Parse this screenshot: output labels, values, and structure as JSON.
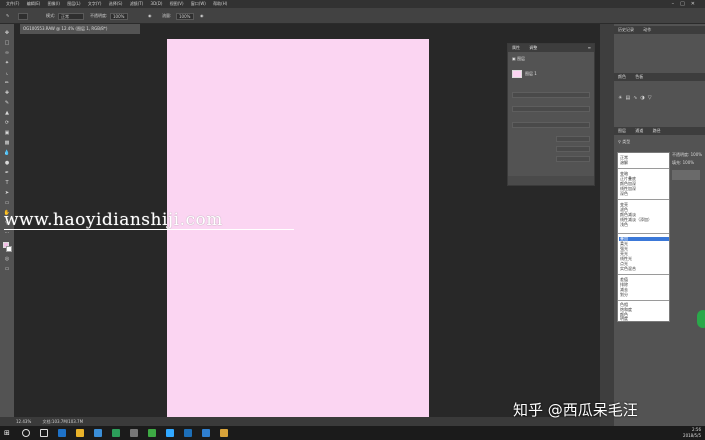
{
  "menubar": {
    "items": [
      "文件(F)",
      "编辑(E)",
      "图像(I)",
      "图层(L)",
      "文字(Y)",
      "选择(S)",
      "滤镜(T)",
      "3D(D)",
      "视图(V)",
      "窗口(W)",
      "帮助(H)"
    ]
  },
  "options": {
    "mode_label": "模式:",
    "mode_value": "正常",
    "opacity_label": "不透明度:",
    "opacity_value": "100%",
    "flow_label": "流量:",
    "flow_value": "100%",
    "smooth_label": "平滑:"
  },
  "doc_tab": "OG100553.RAW @ 12.4% (图层 1, RGB/8*)",
  "statusbar": {
    "zoom": "12.43%",
    "doc_info": "文档:103.7M/103.7M"
  },
  "watermark": "www.haoyidianshiji.com",
  "properties_panel": {
    "tabs": [
      "属性",
      "调整"
    ],
    "section": "图层",
    "layer_name": "图层 1"
  },
  "right_dock": {
    "panel_top_tabs": [
      "历史记录",
      "动作"
    ],
    "panel_mid_tabs": [
      "颜色",
      "色板"
    ],
    "layers_tabs": [
      "图层",
      "通道",
      "路径"
    ],
    "kind_label": "类型",
    "opacity_label": "不透明度:",
    "opacity_value": "100%",
    "fill_label": "填充:",
    "fill_value": "100%"
  },
  "blend_modes": {
    "group1": [
      "正常",
      "溶解"
    ],
    "group2": [
      "变暗",
      "正片叠底",
      "颜色加深",
      "线性加深",
      "深色"
    ],
    "group3": [
      "变亮",
      "滤色",
      "颜色减淡",
      "线性减淡（添加）",
      "浅色"
    ],
    "group4": [
      "叠加",
      "柔光",
      "强光",
      "亮光",
      "线性光",
      "点光",
      "实色混合"
    ],
    "group5": [
      "差值",
      "排除",
      "减去",
      "划分"
    ],
    "group6": [
      "色相",
      "饱和度",
      "颜色",
      "明度"
    ],
    "selected": "叠加"
  },
  "attribution": "知乎 @西瓜呆毛汪",
  "taskbar": {
    "time": "2:56",
    "date": "2018/5/5"
  },
  "colors": {
    "document_fill": "#fbd5f2",
    "workspace": "#282828",
    "panel": "#535353",
    "selection": "#3b78d8"
  }
}
